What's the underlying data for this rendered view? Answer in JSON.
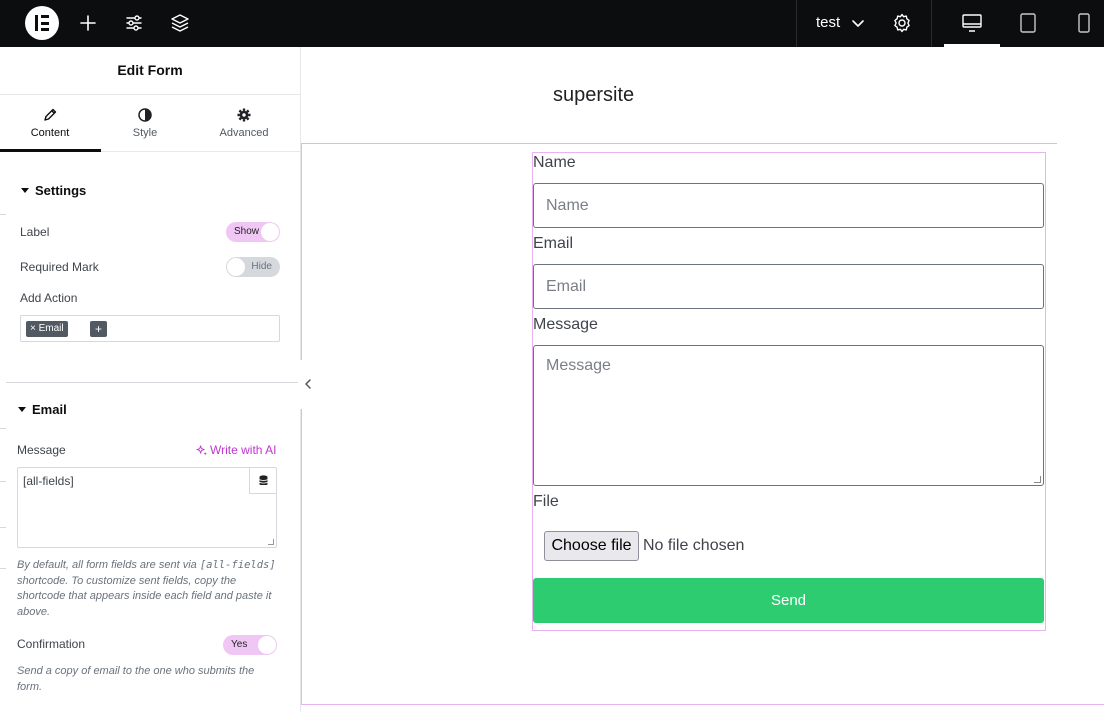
{
  "topbar": {
    "site_name": "test",
    "icons": [
      "elementor-logo",
      "plus-icon",
      "sliders-icon",
      "layers-icon",
      "chevron-down-icon",
      "gear-icon",
      "desktop-icon",
      "tablet-icon",
      "mobile-icon"
    ]
  },
  "panel": {
    "title": "Edit Form",
    "tabs": [
      {
        "label": "Content",
        "icon": "pencil-icon",
        "active": true
      },
      {
        "label": "Style",
        "icon": "contrast-icon",
        "active": false
      },
      {
        "label": "Advanced",
        "icon": "gear-icon",
        "active": false
      }
    ],
    "settings": {
      "heading": "Settings",
      "label_label": "Label",
      "label_toggle": "Show",
      "required_label": "Required Mark",
      "required_toggle": "Hide",
      "action_label": "Add Action",
      "action_chip": "× Email",
      "action_add": "+"
    },
    "email": {
      "heading": "Email",
      "message_label": "Message",
      "ai_link": "Write with AI",
      "message_value": "[all-fields]",
      "help_pre": "By default, all form fields are sent via ",
      "help_code": "[all-fields]",
      "help_post": " shortcode. To customize sent fields, copy the shortcode that appears inside each field and paste it above.",
      "confirmation_label": "Confirmation",
      "confirmation_toggle": "Yes",
      "confirmation_help": "Send a copy of email to the one who submits the form."
    }
  },
  "canvas": {
    "site_title": "supersite",
    "form": {
      "name_label": "Name",
      "name_placeholder": "Name",
      "email_label": "Email",
      "email_placeholder": "Email",
      "message_label": "Message",
      "message_placeholder": "Message",
      "file_label": "File",
      "file_button": "Choose file",
      "file_status": "No file chosen",
      "submit": "Send"
    }
  },
  "colors": {
    "topbar_bg": "#0c0d0e",
    "accent_pink": "#c036d0",
    "toggle_on": "#f0c6f4",
    "send_button": "#2ecc71",
    "outline": "#e9b2f0"
  }
}
